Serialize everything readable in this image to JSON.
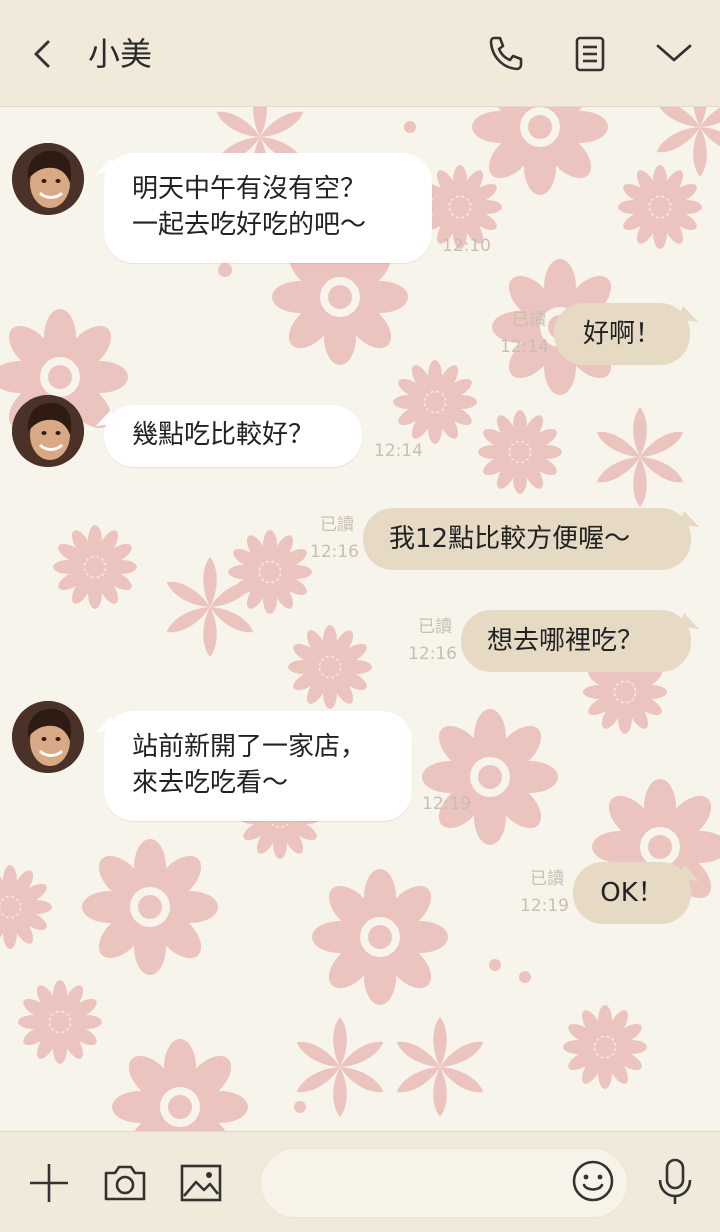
{
  "header": {
    "contact_name": "小美"
  },
  "messages": [
    {
      "side": "in",
      "lines": [
        "明天中午有沒有空？",
        "一起去吃好吃的吧～"
      ],
      "time": "12:10"
    },
    {
      "side": "out",
      "text": "好啊！",
      "read": "已讀",
      "time": "12:14"
    },
    {
      "side": "in",
      "lines": [
        "幾點吃比較好？"
      ],
      "time": "12:14"
    },
    {
      "side": "out",
      "text": "我12點比較方便喔～",
      "read": "已讀",
      "time": "12:16"
    },
    {
      "side": "out",
      "text": "想去哪裡吃？",
      "read": "已讀",
      "time": "12:16"
    },
    {
      "side": "in",
      "lines": [
        "站前新開了一家店，",
        "來去吃吃看～"
      ],
      "time": "12:19"
    },
    {
      "side": "out",
      "text": "OK！",
      "read": "已讀",
      "time": "12:19"
    }
  ],
  "colors": {
    "header_bg": "#f1eadb",
    "chat_bg": "#f7f4ec",
    "outgoing_bubble": "#e6dac4",
    "incoming_bubble": "#ffffff",
    "pattern": "#e8b3ae"
  },
  "icons": {
    "header": [
      "back-icon",
      "phone-icon",
      "notes-icon",
      "chevron-down-icon"
    ],
    "footer": [
      "plus-icon",
      "camera-icon",
      "image-icon",
      "emoji-icon",
      "mic-icon"
    ]
  }
}
